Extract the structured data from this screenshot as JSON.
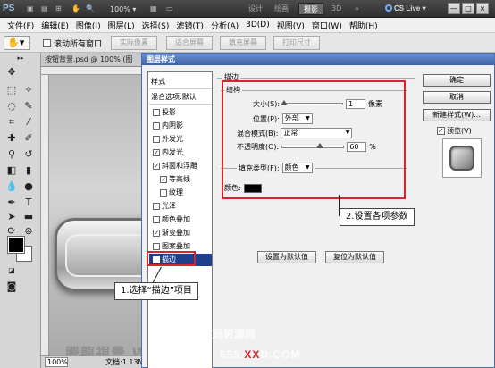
{
  "app": {
    "logo": "PS",
    "zoom": "100%",
    "workspaces": [
      "设计",
      "绘画",
      "摄影",
      "3D"
    ],
    "workspace_more": "»",
    "cs_live": "CS Live",
    "window_buttons": [
      "—",
      "□",
      "×"
    ]
  },
  "menu": [
    "文件(F)",
    "编辑(E)",
    "图像(I)",
    "图层(L)",
    "选择(S)",
    "滤镜(T)",
    "分析(A)",
    "3D(D)",
    "视图(V)",
    "窗口(W)",
    "帮助(H)"
  ],
  "options": {
    "tool_icon": "✋▾",
    "scroll_all": "滚动所有窗口",
    "buttons": [
      "实际像素",
      "适合屏幕",
      "填充屏幕",
      "打印尺寸"
    ]
  },
  "document": {
    "tab": "按钮背景.psd @ 100% (图",
    "zoom": "100%",
    "doc_size": "文档:1.13M/3.12M",
    "watermark": "騰龍視覺 WWW.TENL"
  },
  "dialog": {
    "title": "图层样式",
    "list_header": "样式",
    "blend_header": "混合选项:默认",
    "items": [
      {
        "label": "投影",
        "checked": false,
        "sub": false
      },
      {
        "label": "内阴影",
        "checked": false,
        "sub": false
      },
      {
        "label": "外发光",
        "checked": false,
        "sub": false
      },
      {
        "label": "内发光",
        "checked": true,
        "sub": false
      },
      {
        "label": "斜面和浮雕",
        "checked": true,
        "sub": false
      },
      {
        "label": "等高线",
        "checked": true,
        "sub": true
      },
      {
        "label": "纹理",
        "checked": false,
        "sub": true
      },
      {
        "label": "光泽",
        "checked": false,
        "sub": false
      },
      {
        "label": "颜色叠加",
        "checked": false,
        "sub": false
      },
      {
        "label": "渐变叠加",
        "checked": true,
        "sub": false
      },
      {
        "label": "图案叠加",
        "checked": false,
        "sub": false
      },
      {
        "label": "描边",
        "checked": true,
        "sub": false,
        "selected": true
      }
    ],
    "section_title": "描边",
    "structure_title": "结构",
    "size_label": "大小(S):",
    "size_value": "1",
    "size_unit": "像素",
    "size_level": 0.02,
    "position_label": "位置(P):",
    "position_value": "外部",
    "blend_label": "混合模式(B):",
    "blend_value": "正常",
    "opacity_label": "不透明度(O):",
    "opacity_value": "60",
    "opacity_unit": "%",
    "opacity_level": 0.6,
    "fill_type_label": "填充类型(F):",
    "fill_type_value": "颜色",
    "color_label": "颜色:",
    "stroke_color": "#000000",
    "set_default": "设置为默认值",
    "reset_default": "复位为默认值",
    "ok": "确定",
    "cancel": "取消",
    "new_style": "新建样式(W)...",
    "preview": "预览(V)"
  },
  "annotations": {
    "step1": "1.选择“描边”项目",
    "step2": "2.设置各项参数",
    "highlight_color": "#d9232d"
  },
  "watermarks": {
    "mid": "数码资源网",
    "bottom_left": "555.",
    "bottom_xx": "XX",
    "bottom_right": "D.COM"
  }
}
